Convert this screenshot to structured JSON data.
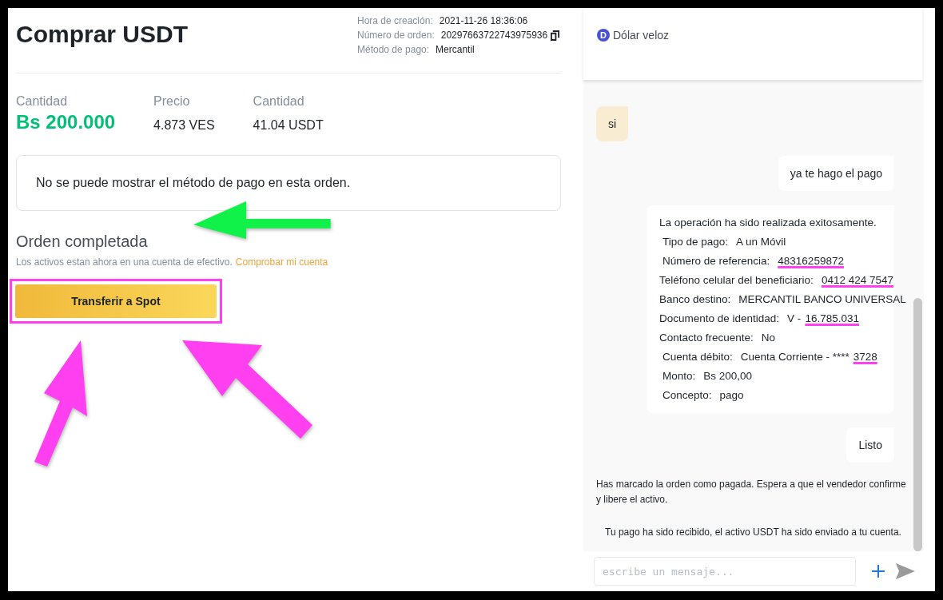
{
  "order": {
    "title": "Comprar USDT",
    "meta": [
      {
        "label": "Hora de creación:",
        "value": "2021-11-26 18:36:06",
        "copy": false
      },
      {
        "label": "Número de orden:",
        "value": "20297663722743975936",
        "copy": true
      },
      {
        "label": "Método de pago:",
        "value": "Mercantil",
        "copy": false
      }
    ],
    "stats": [
      {
        "label": "Cantidad",
        "value": "Bs 200.000",
        "highlight": true
      },
      {
        "label": "Precio",
        "value": "4.873 VES",
        "highlight": false
      },
      {
        "label": "Cantidad",
        "value": "41.04 USDT",
        "highlight": false
      }
    ],
    "notice": "No se puede mostrar el método de pago en esta orden.",
    "status_title": "Orden completada",
    "status_text": "Los activos estan ahora en una cuenta de efectivo.",
    "status_link": "Comprobar mi cuenta",
    "button": "Transferir a Spot"
  },
  "chat": {
    "contact": {
      "initial": "D",
      "name": "Dólar veloz"
    },
    "messages": [
      {
        "kind": "incoming",
        "text": "si"
      },
      {
        "kind": "outgoing",
        "text": "ya te hago el pago"
      },
      {
        "kind": "receipt",
        "lines": [
          {
            "label": "La operación ha sido realizada exitosamente.",
            "indent": false
          },
          {
            "label": "Tipo de pago:",
            "value": "A un Móvil",
            "indent": true
          },
          {
            "label": "Número de referencia:",
            "redacted_value": "48316259872",
            "indent": true
          },
          {
            "label": "Teléfono celular del beneficiario:",
            "redacted_value": "0412 424 7547",
            "indent": false
          },
          {
            "label": "Banco destino:",
            "value": "MERCANTIL BANCO UNIVERSAL",
            "indent": false
          },
          {
            "label": "Documento de identidad:",
            "value": "V -",
            "redacted_value": "16.785.031",
            "indent": false
          },
          {
            "label": "Contacto frecuente:",
            "value": "No",
            "indent": false
          },
          {
            "label": "Cuenta débito:",
            "value": "Cuenta Corriente - ****",
            "redacted_value": "3728",
            "indent": true
          },
          {
            "label": "Monto:",
            "value": "Bs 200,00",
            "indent": true
          },
          {
            "label": "Concepto:",
            "value": "pago",
            "indent": true
          }
        ]
      },
      {
        "kind": "outgoing",
        "text": "Listo"
      },
      {
        "kind": "system",
        "text": "Has marcado la orden como pagada. Espera a que el vendedor confirme y libere el activo."
      },
      {
        "kind": "system_center",
        "text": "Tu pago ha sido recibido, el activo USDT ha sido enviado a tu cuenta."
      }
    ],
    "input": {
      "placeholder": "escribe un mensaje..."
    }
  }
}
